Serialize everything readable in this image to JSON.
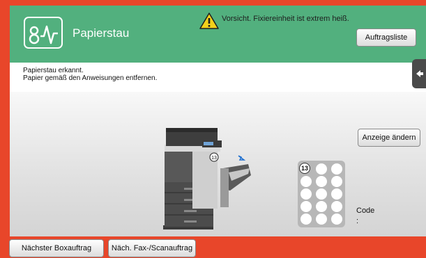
{
  "header": {
    "title": "Papierstau",
    "warning": "Vorsicht. Fixiereinheit ist extrem heiß.",
    "jobs_button": "Auftragsliste"
  },
  "message": {
    "line1": "Papierstau erkannt.",
    "line2": "Papier gemäß den Anweisungen entfernen."
  },
  "main": {
    "view_button": "Anzeige ändern",
    "jam_marker": "13",
    "keypad_number": "13",
    "code_label": "Code",
    "code_value": ":"
  },
  "footer": {
    "box_button": "Nächster Boxauftrag",
    "fax_button": "Näch. Fax-/Scanauftrag"
  },
  "colors": {
    "frame": "#e8462a",
    "header": "#52b07e"
  },
  "icons": {
    "logo": "waveform-icon",
    "warning": "warning-triangle-icon",
    "back": "arrow-left-icon"
  }
}
